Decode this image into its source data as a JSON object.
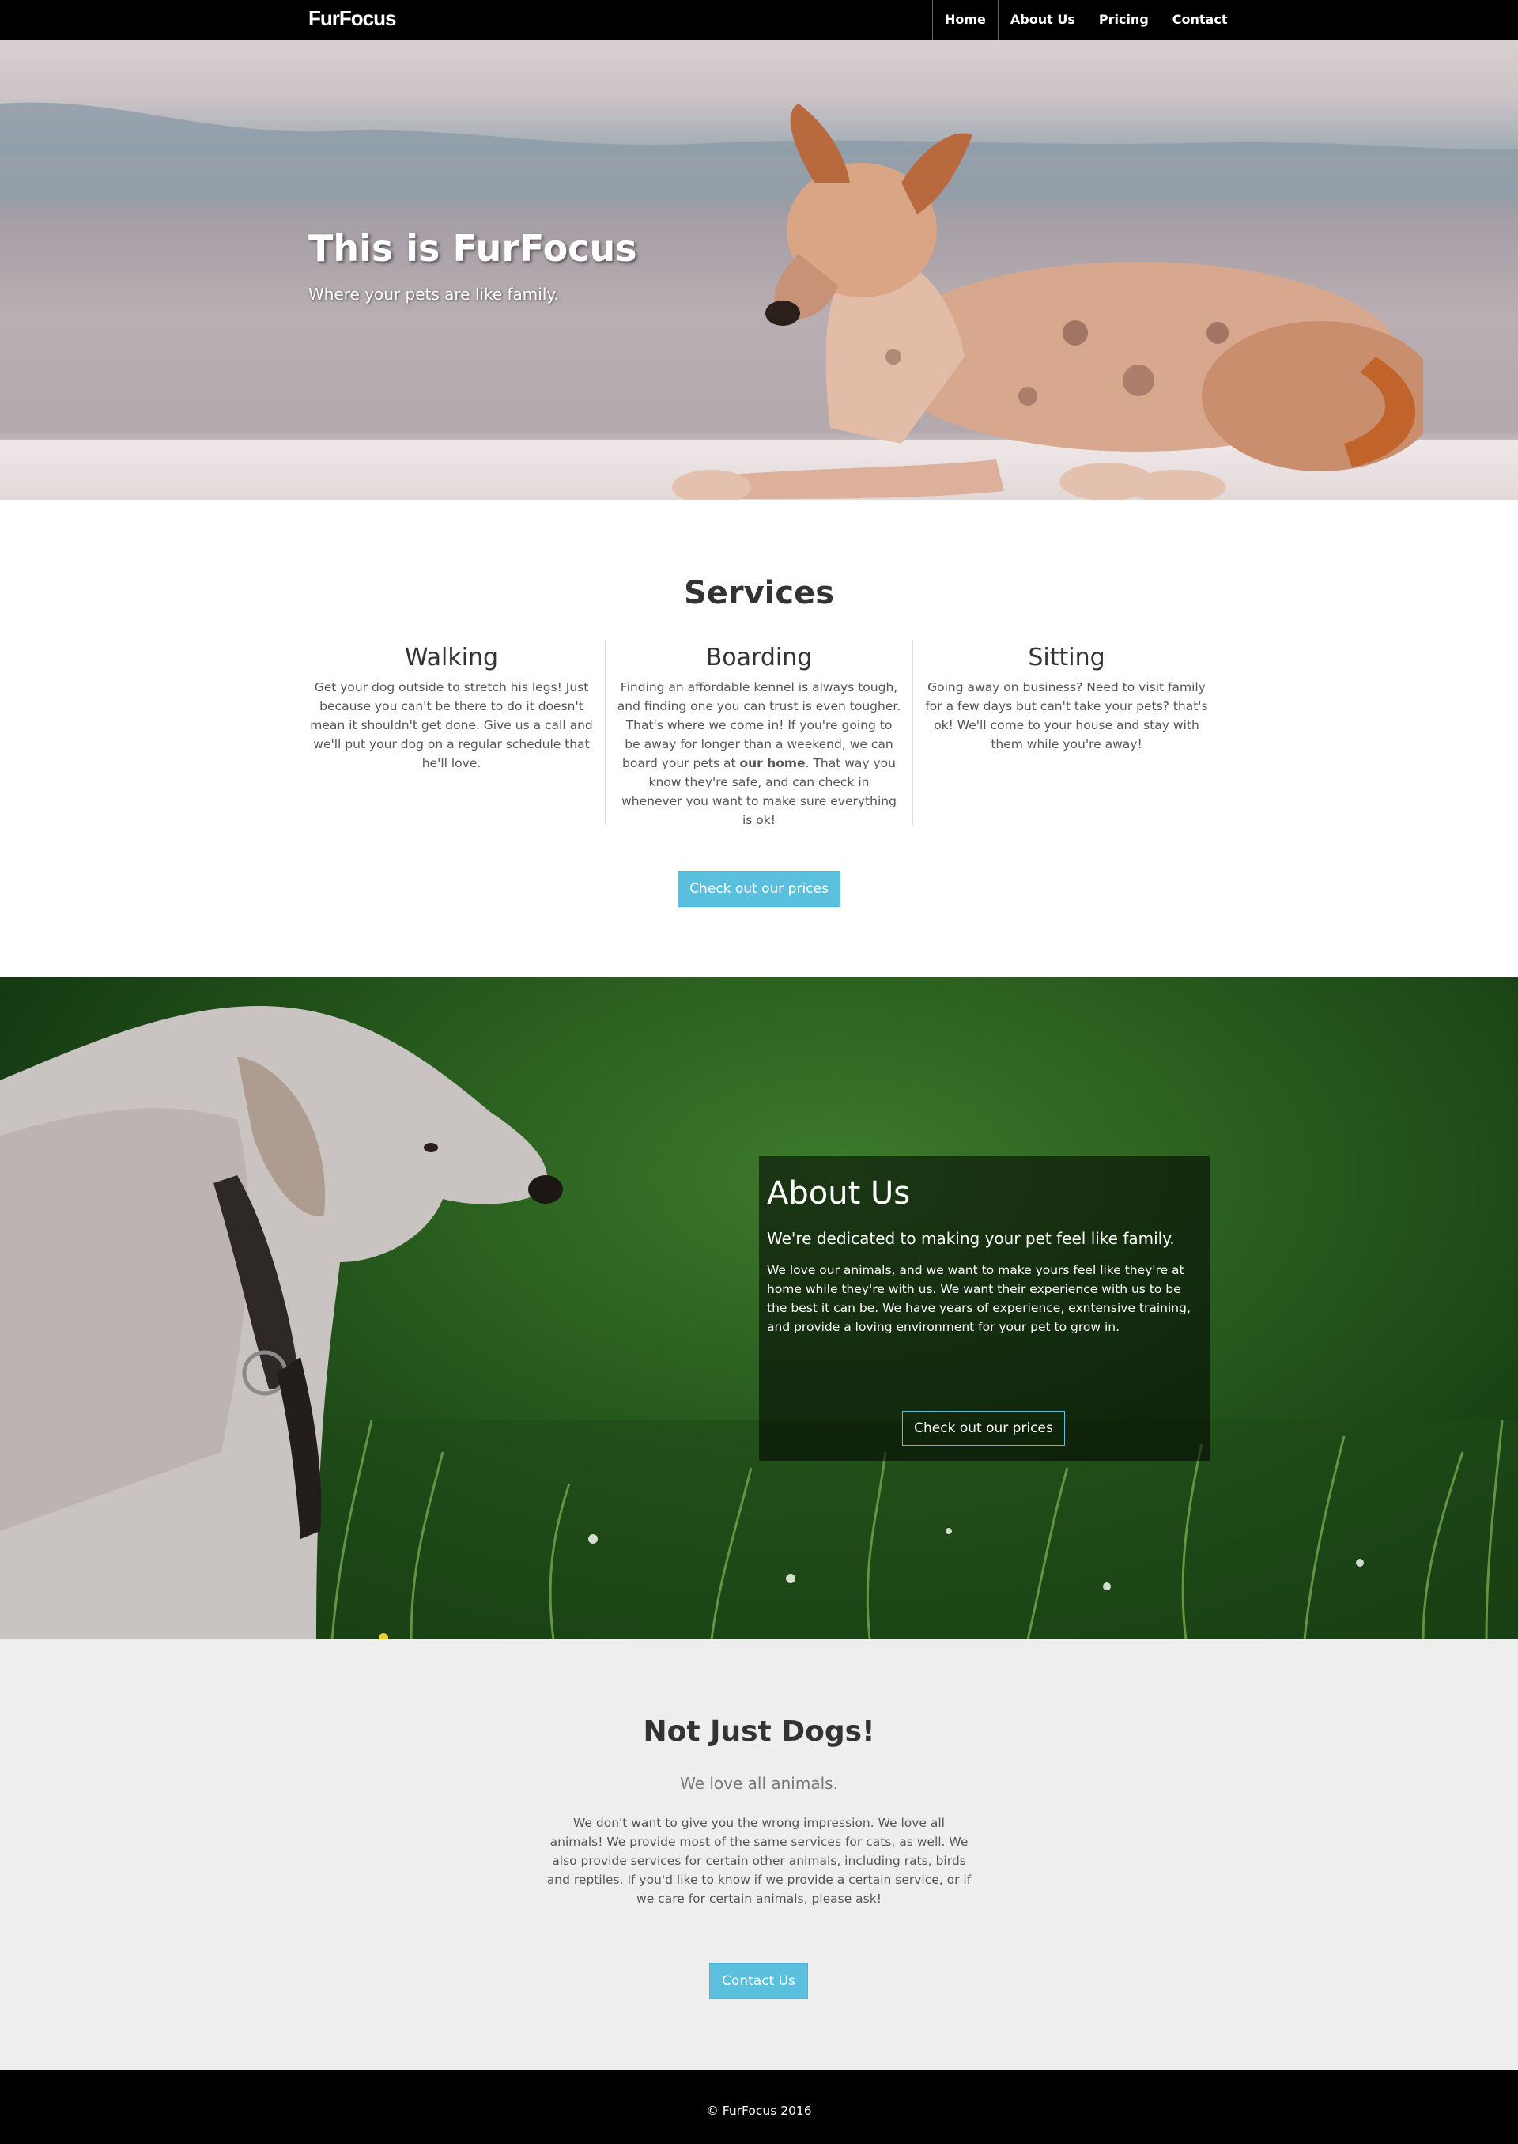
{
  "navbar": {
    "brand": "FurFocus",
    "links": [
      {
        "label": "Home",
        "active": true
      },
      {
        "label": "About Us",
        "active": false
      },
      {
        "label": "Pricing",
        "active": false
      },
      {
        "label": "Contact",
        "active": false
      }
    ]
  },
  "hero": {
    "title": "This is FurFocus",
    "subtitle": "Where your pets are like family."
  },
  "services": {
    "title": "Services",
    "items": [
      {
        "title": "Walking",
        "text": "Get your dog outside to stretch his legs! Just because you can't be there to do it doesn't mean it shouldn't get done. Give us a call and we'll put your dog on a regular schedule that he'll love."
      },
      {
        "title": "Boarding",
        "text_before": "Finding an affordable kennel is always tough, and finding one you can trust is even tougher. That's where we come in! If you're going to be away for longer than a weekend, we can board your pets at ",
        "text_bold": "our home",
        "text_after": ". That way you know they're safe, and can check in whenever you want to make sure everything is ok!"
      },
      {
        "title": "Sitting",
        "text": "Going away on business? Need to visit family for a few days but can't take your pets? that's ok! We'll come to your house and stay with them while you're away!"
      }
    ],
    "button_label": "Check out our prices"
  },
  "about": {
    "title": "About Us",
    "lead": "We're dedicated to making your pet feel like family.",
    "text": "We love our animals, and we want to make yours feel like they're at home while they're with us. We want their experience with us to be the best it can be. We have years of experience, exntensive training, and provide a loving environment for your pet to grow in.",
    "button_label": "Check out our prices"
  },
  "not_just_dogs": {
    "title": "Not Just Dogs!",
    "lead": "We love all animals.",
    "text": "We don't want to give you the wrong impression. We love all animals! We provide most of the same services for cats, as well. We also provide services for certain other animals, including rats, birds and reptiles. If you'd like to know if we provide a certain service, or if we care for certain animals, please ask!",
    "button_label": "Contact Us"
  },
  "footer": {
    "copyright": "© FurFocus 2016"
  },
  "colors": {
    "navbar_bg": "#000000",
    "accent": "#5bc0de",
    "section_gray": "#eeeeee"
  }
}
